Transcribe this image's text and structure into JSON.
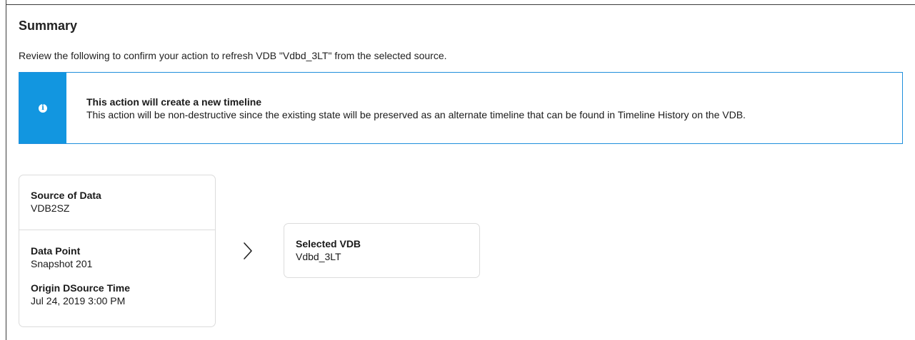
{
  "summary": {
    "title": "Summary",
    "intro": "Review the following to confirm your action to refresh VDB \"Vdbd_3LT\" from the selected source."
  },
  "banner": {
    "icon": "info-icon",
    "title": "This action will create a new timeline",
    "text": "This action will be non-destructive since the existing state will be preserved as an alternate timeline that can be found in Timeline History on the VDB.",
    "accent_color": "#1296e0"
  },
  "source": {
    "source_label": "Source of Data",
    "source_value": "VDB2SZ",
    "datapoint_label": "Data Point",
    "datapoint_value": "Snapshot 201",
    "origin_label": "Origin DSource Time",
    "origin_value": "Jul 24, 2019 3:00 PM"
  },
  "arrow_icon": "chevron-right-icon",
  "target": {
    "label": "Selected VDB",
    "value": "Vdbd_3LT"
  }
}
